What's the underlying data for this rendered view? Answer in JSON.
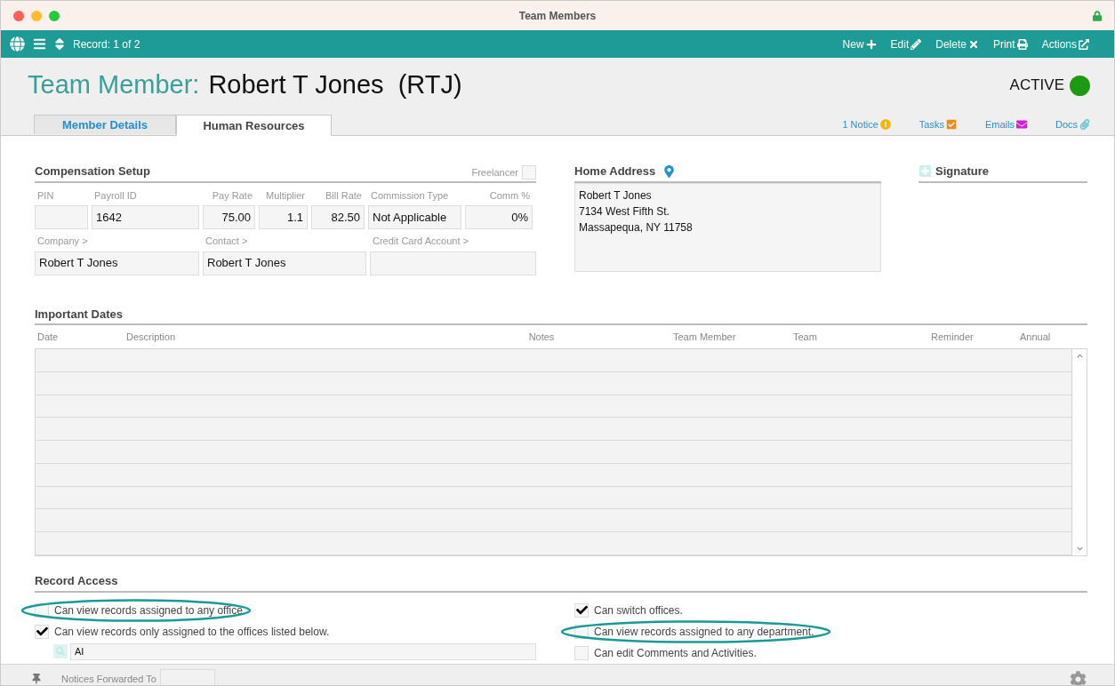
{
  "window": {
    "title": "Team Members"
  },
  "toolbar": {
    "record": "Record: 1 of 2",
    "actions": [
      {
        "label": "New",
        "kind": "plus"
      },
      {
        "label": "Edit",
        "kind": "pencil"
      },
      {
        "label": "Delete",
        "kind": "x"
      },
      {
        "label": "Print",
        "kind": "print"
      },
      {
        "label": "Actions",
        "kind": "arrow"
      }
    ]
  },
  "header": {
    "prefix": "Team Member:",
    "name": "Robert T Jones  (RTJ)",
    "status": "ACTIVE",
    "active": true
  },
  "tabs": [
    {
      "label": "Member Details",
      "selected": false
    },
    {
      "label": "Human Resources",
      "selected": true
    }
  ],
  "links": [
    {
      "label": "1 Notice",
      "kind": "notice"
    },
    {
      "label": "Tasks",
      "kind": "tasks"
    },
    {
      "label": "Emails",
      "kind": "emails"
    },
    {
      "label": "Docs",
      "kind": "docs"
    }
  ],
  "compensation": {
    "title": "Compensation Setup",
    "freelancer": {
      "label": "Freelancer",
      "checked": false
    },
    "fields": [
      {
        "label": "PIN",
        "kind": "text"
      },
      {
        "label": "Payroll ID",
        "value": "1642",
        "kind": "text"
      },
      {
        "label": "Pay Rate",
        "value": "75.00",
        "kind": "number"
      },
      {
        "label": "Multiplier",
        "value": "1.1",
        "kind": "number"
      },
      {
        "label": "Bill Rate",
        "value": "82.50",
        "kind": "number"
      },
      {
        "label": "Commission Type",
        "value": "Not Applicable",
        "kind": "text"
      },
      {
        "label": "Comm %",
        "value": "0%",
        "kind": "number"
      }
    ],
    "links": [
      {
        "label": "Company >",
        "value": "Robert T Jones"
      },
      {
        "label": "Contact >",
        "value": "Robert T Jones"
      },
      {
        "label": "Credit Card Account >"
      }
    ]
  },
  "home_address": {
    "title": "Home Address",
    "lines": [
      "Robert T Jones",
      "7134 West Fifth St.",
      "Massapequa, NY 11758"
    ]
  },
  "signature": {
    "title": "Signature"
  },
  "important_dates": {
    "title": "Important Dates",
    "columns": [
      "Date",
      "Description",
      "Notes",
      "Team Member",
      "Team",
      "Reminder",
      "Annual"
    ]
  },
  "record_access": {
    "title": "Record Access",
    "left": [
      {
        "label": "Can view records assigned to any office.",
        "checked": false,
        "highlighted": true
      },
      {
        "label": "Can view records only assigned to the offices listed below.",
        "checked": true,
        "highlighted": false
      }
    ],
    "office_value": "AI",
    "right": [
      {
        "label": "Can switch offices.",
        "checked": true,
        "highlighted": false
      },
      {
        "label": "Can view records assigned to any department.",
        "checked": false,
        "highlighted": true
      },
      {
        "label": "Can edit Comments and Activities.",
        "checked": false,
        "highlighted": false
      }
    ]
  },
  "footer": {
    "label": "Notices Forwarded To"
  }
}
